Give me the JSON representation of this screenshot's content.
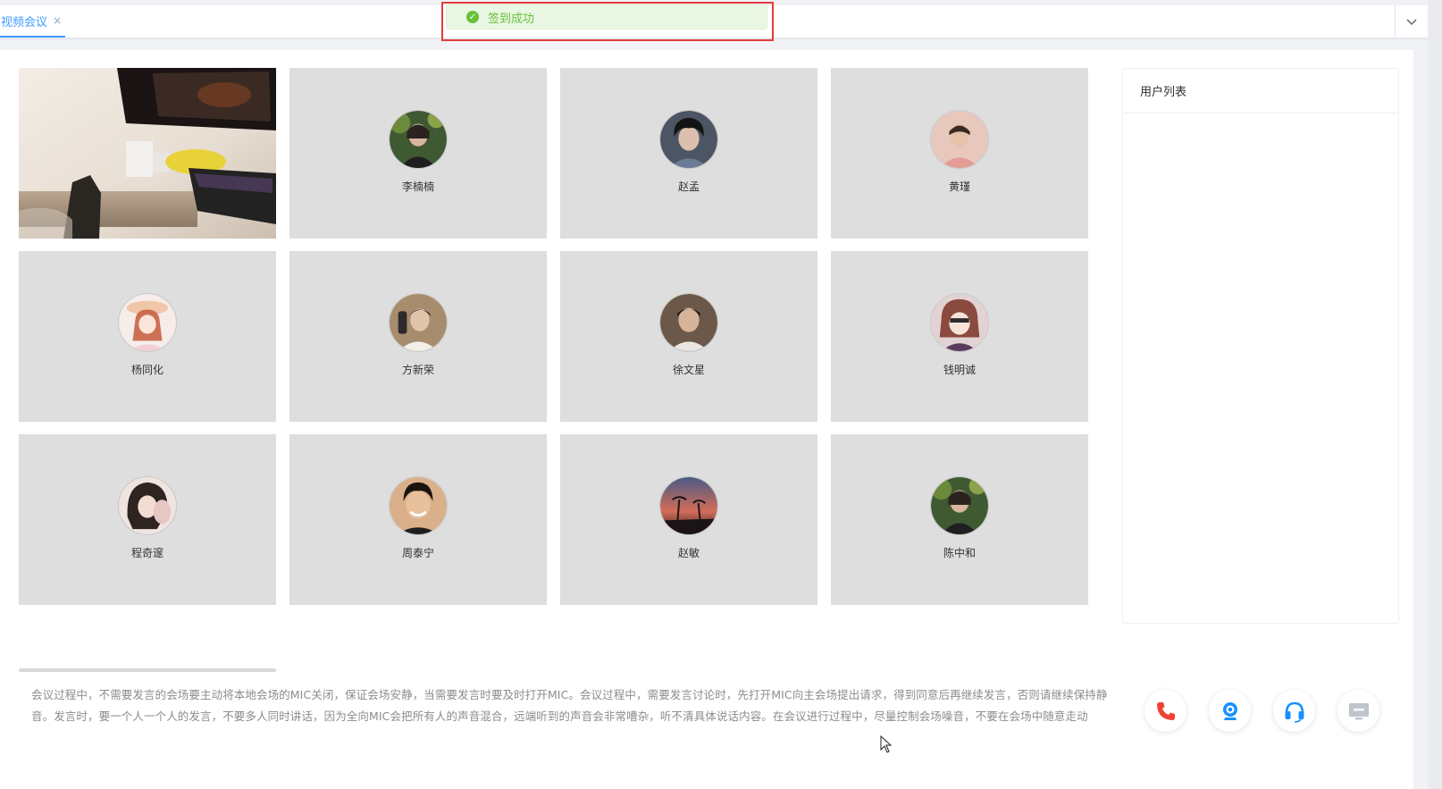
{
  "tabs": [
    {
      "label": "视频会议",
      "close": "×"
    }
  ],
  "toast": {
    "message": "签到成功",
    "color": "#67c23a"
  },
  "participants": [
    {
      "name": "",
      "video": true
    },
    {
      "name": "李楠楠",
      "avatar": "avatar-forest-portrait"
    },
    {
      "name": "赵孟",
      "avatar": "avatar-curly-hair"
    },
    {
      "name": "黄瑾",
      "avatar": "avatar-pink-shirt"
    },
    {
      "name": "杨同化",
      "avatar": "avatar-anime-girl-hat"
    },
    {
      "name": "方新荣",
      "avatar": "avatar-selfie"
    },
    {
      "name": "徐文星",
      "avatar": "avatar-dark-portrait"
    },
    {
      "name": "钱明诚",
      "avatar": "avatar-anime-boy"
    },
    {
      "name": "程奇邃",
      "avatar": "avatar-anime-girl-dark-hair"
    },
    {
      "name": "周泰宁",
      "avatar": "avatar-smiling-boy"
    },
    {
      "name": "赵敏",
      "avatar": "avatar-palm-sunset"
    },
    {
      "name": "陈中和",
      "avatar": "avatar-forest-portrait"
    }
  ],
  "notice": "会议过程中，不需要发言的会场要主动将本地会场的MIC关闭，保证会场安静，当需要发言时要及时打开MIC。会议过程中，需要发言讨论时，先打开MIC向主会场提出请求，得到同意后再继续发言，否则请继续保持静音。发言时，要一个人一个人的发言，不要多人同时讲话，因为全向MIC会把所有人的声音混合，远端听到的声音会非常嘈杂，听不清具体说话内容。在会议进行过程中，尽量控制会场噪音，不要在会场中随意走动",
  "userlist": {
    "title": "用户列表"
  },
  "controls": [
    {
      "icon": "phone-hangup-icon",
      "color": "#f04134"
    },
    {
      "icon": "camera-icon",
      "color": "#1890ff"
    },
    {
      "icon": "headset-icon",
      "color": "#1890ff"
    },
    {
      "icon": "screen-share-icon",
      "color": "#c0c4cc"
    }
  ]
}
